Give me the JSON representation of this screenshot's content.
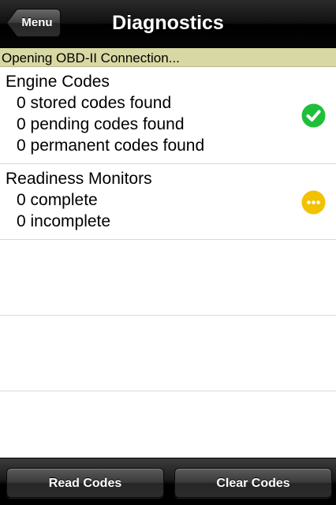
{
  "navbar": {
    "back_label": "Menu",
    "title": "Diagnostics"
  },
  "status": {
    "text": "Opening OBD-II Connection..."
  },
  "sections": [
    {
      "title": "Engine Codes",
      "lines": [
        "0 stored codes found",
        "0 pending codes found",
        "0 permanent codes found"
      ],
      "status_icon": "checkmark-icon",
      "status_color": "#1fbf3a"
    },
    {
      "title": "Readiness Monitors",
      "lines": [
        "0 complete",
        "0 incomplete"
      ],
      "status_icon": "ellipsis-icon",
      "status_color": "#f2c200"
    }
  ],
  "toolbar": {
    "read_label": "Read Codes",
    "clear_label": "Clear Codes"
  }
}
